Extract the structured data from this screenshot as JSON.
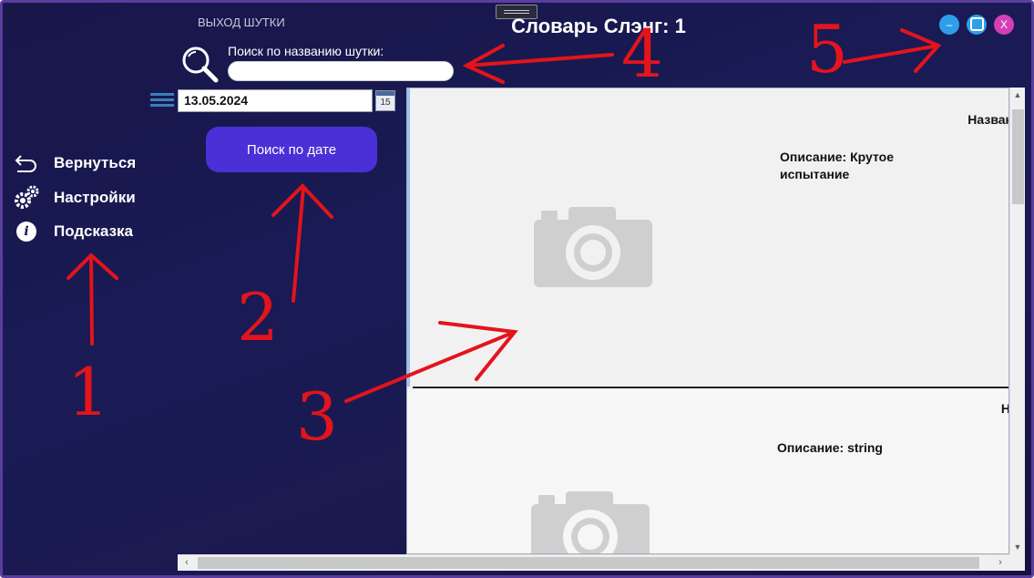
{
  "window": {
    "title": "Словарь Слэнг: 1",
    "caption": "ВЫХОД ШУТКИ",
    "controls": {
      "minimize": "–",
      "close": "X"
    }
  },
  "search": {
    "label": "Поиск по названию шутки:",
    "value": "",
    "placeholder": ""
  },
  "date_filter": {
    "value": "13.05.2024",
    "calendar_day": "15",
    "button_label": "Поиск по дате"
  },
  "nav": {
    "items": [
      {
        "label": "Вернуться",
        "icon": "back-arrow-icon"
      },
      {
        "label": "Настройки",
        "icon": "gears-icon"
      },
      {
        "label": "Подсказка",
        "icon": "info-icon"
      }
    ]
  },
  "jokes": [
    {
      "name": "Назван",
      "description": "Описание: Крутое испытание",
      "image": "camera-placeholder-icon"
    },
    {
      "name": "Н",
      "description": "Описание: string",
      "image": "camera-placeholder-icon"
    }
  ],
  "annotations": {
    "numbers": [
      "1",
      "2",
      "3",
      "4",
      "5"
    ],
    "color": "#e3141c"
  },
  "colors": {
    "background": "#17174a",
    "accent_button": "#4a30d6",
    "window_border": "#5a3d9e",
    "control_blue": "#2f9ee8",
    "control_close": "#d43fb8"
  }
}
